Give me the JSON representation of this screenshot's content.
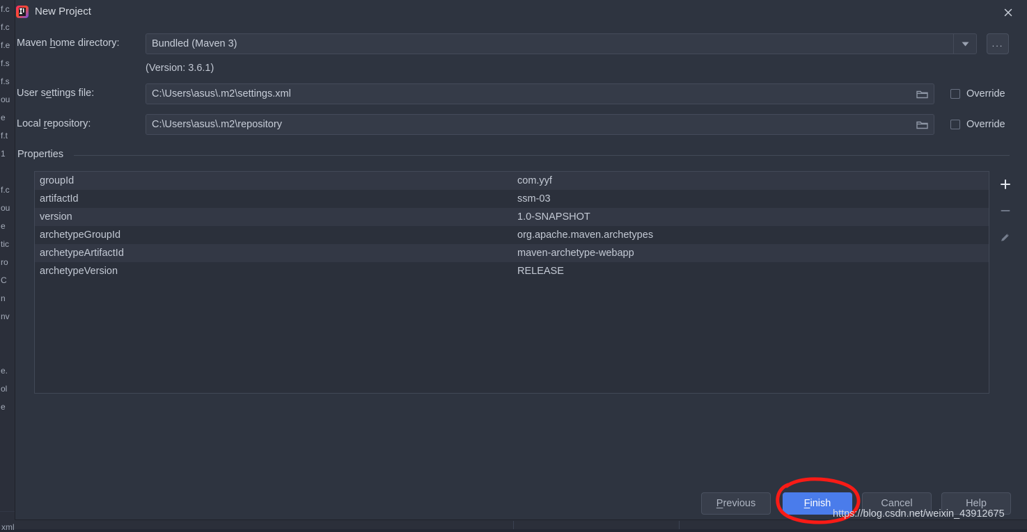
{
  "window": {
    "title": "New Project",
    "app_icon": "intellij-idea-icon",
    "close_icon": "close-icon"
  },
  "form": {
    "maven_home": {
      "label_before": "Maven ",
      "label_mnemonic": "h",
      "label_after": "ome directory:",
      "value": "Bundled (Maven 3)",
      "dropdown_icon": "chevron-down-icon",
      "browse_label": "...",
      "version_note": "(Version: 3.6.1)"
    },
    "user_settings": {
      "label_before": "User s",
      "label_mnemonic": "e",
      "label_after": "ttings file:",
      "value": "C:\\Users\\asus\\.m2\\settings.xml",
      "folder_icon": "folder-icon",
      "override_label": "Override",
      "override_checked": false
    },
    "local_repository": {
      "label_before": "Local ",
      "label_mnemonic": "r",
      "label_after": "epository:",
      "value": "C:\\Users\\asus\\.m2\\repository",
      "folder_icon": "folder-icon",
      "override_label": "Override",
      "override_checked": false
    }
  },
  "properties": {
    "group_title": "Properties",
    "rows": [
      {
        "key": "groupId",
        "value": "com.yyf"
      },
      {
        "key": "artifactId",
        "value": "ssm-03"
      },
      {
        "key": "version",
        "value": "1.0-SNAPSHOT"
      },
      {
        "key": "archetypeGroupId",
        "value": "org.apache.maven.archetypes"
      },
      {
        "key": "archetypeArtifactId",
        "value": "maven-archetype-webapp"
      },
      {
        "key": "archetypeVersion",
        "value": "RELEASE"
      }
    ],
    "toolbar": {
      "add_icon": "plus-icon",
      "remove_icon": "minus-icon",
      "edit_icon": "pencil-icon"
    }
  },
  "footer": {
    "previous": {
      "before": "",
      "mnemonic": "P",
      "after": "revious"
    },
    "finish": {
      "before": "",
      "mnemonic": "F",
      "after": "inish"
    },
    "cancel": {
      "label": "Cancel"
    },
    "help": {
      "label": "Help"
    }
  },
  "annotation": {
    "shape": "hand-drawn-red-ellipse",
    "color": "#f81b16",
    "target": "Finish"
  },
  "watermark": {
    "text": "https://blog.csdn.net/weixin_43912675"
  },
  "background": {
    "left_fragments": [
      "f.c",
      "f.c",
      "f.e",
      "f.s",
      "f.s",
      "ou",
      "e",
      "f.t",
      "1",
      "",
      "f.c",
      "ou",
      "e",
      "tic",
      "ro",
      "C",
      "n",
      "nv",
      "",
      "",
      "e.",
      "ol",
      "e"
    ],
    "bottom_tab": "xml"
  },
  "colors": {
    "dialog_bg": "#2e3440",
    "field_bg": "#353b48",
    "accent": "#4a7ceb",
    "annotation_red": "#f81b16",
    "text": "#c9cfd9"
  }
}
